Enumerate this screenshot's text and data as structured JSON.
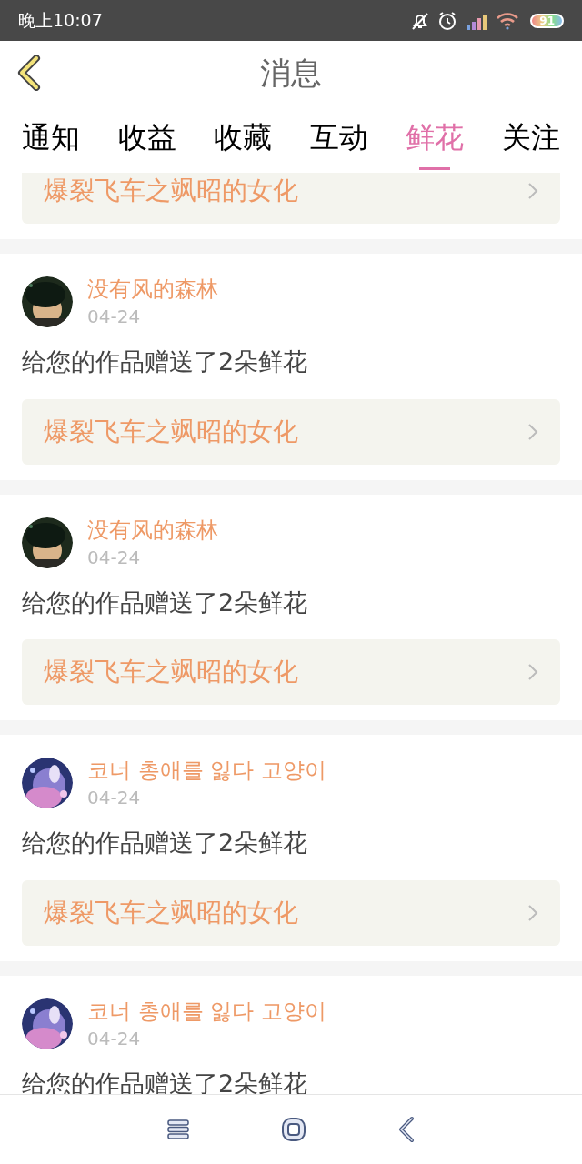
{
  "status_bar": {
    "time": "晚上10:07",
    "battery": "91"
  },
  "header": {
    "title": "消息"
  },
  "tabs": [
    {
      "label": "通知",
      "selected": false
    },
    {
      "label": "收益",
      "selected": false
    },
    {
      "label": "收藏",
      "selected": false
    },
    {
      "label": "互动",
      "selected": false
    },
    {
      "label": "鲜花",
      "selected": true
    },
    {
      "label": "关注",
      "selected": false
    }
  ],
  "messages": [
    {
      "work": "爆裂飞车之飒昭的女化"
    },
    {
      "user": "没有风的森林",
      "date": "04-24",
      "text": "给您的作品赠送了2朵鲜花",
      "work": "爆裂飞车之飒昭的女化"
    },
    {
      "user": "没有风的森林",
      "date": "04-24",
      "text": "给您的作品赠送了2朵鲜花",
      "work": "爆裂飞车之飒昭的女化"
    },
    {
      "user": "코너 총애를 잃다 고양이",
      "date": "04-24",
      "text": "给您的作品赠送了2朵鲜花",
      "work": "爆裂飞车之飒昭的女化"
    },
    {
      "user": "코너 총애를 잃다 고양이",
      "date": "04-24",
      "text": "给您的作品赠送了2朵鲜花"
    }
  ]
}
